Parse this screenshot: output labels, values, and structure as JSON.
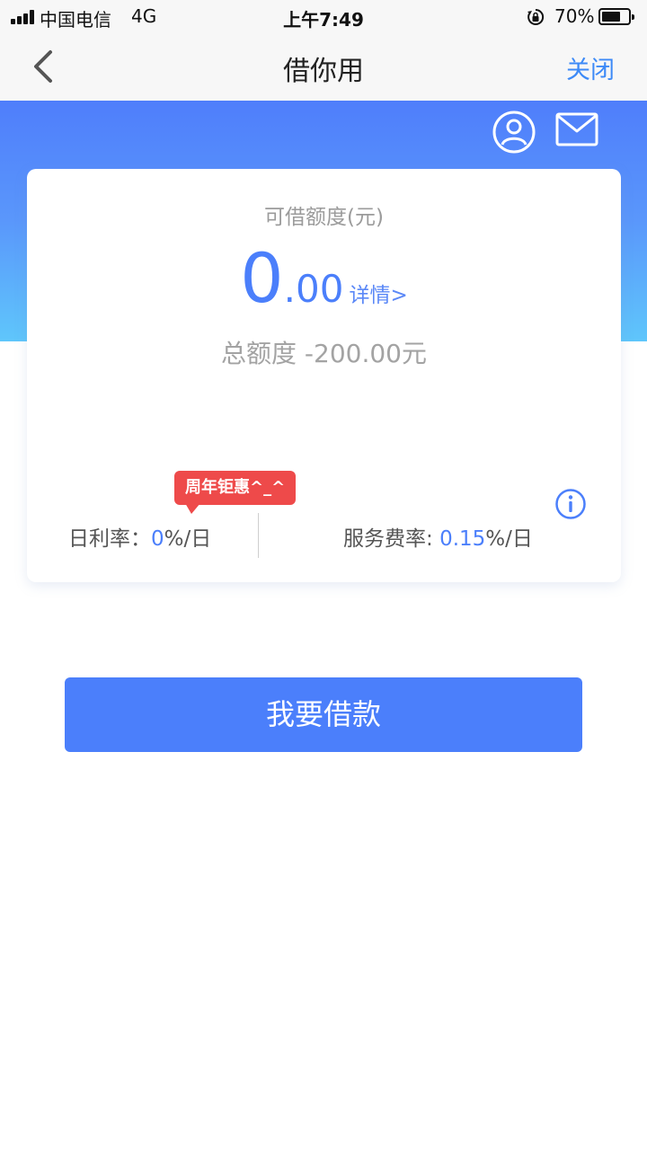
{
  "status_bar": {
    "carrier": "中国电信",
    "network": "4G",
    "time": "上午7:49",
    "battery_percent": "70%",
    "battery_level": 0.7
  },
  "nav": {
    "title": "借你用",
    "close_label": "关闭",
    "back_icon": "chevron-left-icon"
  },
  "header": {
    "icons": [
      "user-icon",
      "mail-icon"
    ]
  },
  "card": {
    "credit_label": "可借额度(元)",
    "amount_integer": "0",
    "amount_decimal": ".00",
    "detail_link": "详情>",
    "total_limit": "总额度 -200.00元",
    "promo_badge": "周年钜惠^_^",
    "daily_rate_label": "日利率：",
    "daily_rate_value": "0",
    "daily_rate_unit": "%/日",
    "service_rate_label": "服务费率: ",
    "service_rate_value": "0.15",
    "service_rate_unit": "%/日"
  },
  "actions": {
    "borrow_label": "我要借款"
  },
  "colors": {
    "brand_blue": "#4b7ffb",
    "promo_red": "#ee4a4a",
    "link_blue": "#3d8af7"
  }
}
